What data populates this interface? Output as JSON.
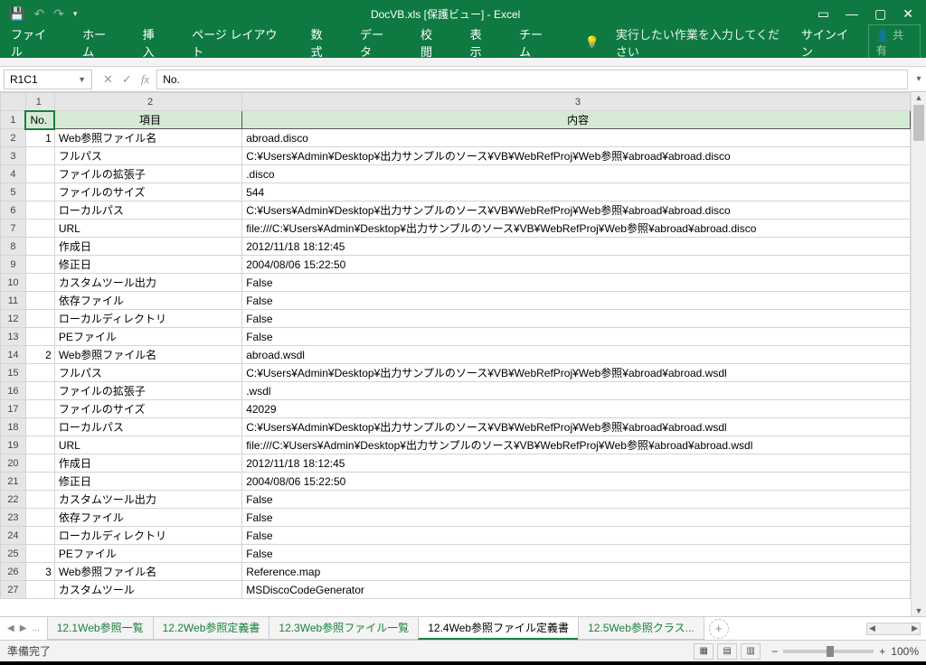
{
  "window": {
    "title": "DocVB.xls  [保護ビュー] - Excel"
  },
  "ribbon": {
    "tabs": [
      "ファイル",
      "ホーム",
      "挿入",
      "ページ レイアウト",
      "数式",
      "データ",
      "校閲",
      "表示",
      "チーム"
    ],
    "tellme": "実行したい作業を入力してください",
    "signin": "サインイン",
    "share": "共有"
  },
  "formula": {
    "namebox": "R1C1",
    "content": "No."
  },
  "columns": {
    "c1": "1",
    "c2": "2",
    "c3": "3"
  },
  "header_row": {
    "no": "No.",
    "item": "項目",
    "content": "内容"
  },
  "rows": [
    {
      "n": "1",
      "item": "Web参照ファイル名",
      "val": "abroad.disco"
    },
    {
      "n": "",
      "item": "フルパス",
      "val": "C:¥Users¥Admin¥Desktop¥出力サンプルのソース¥VB¥WebRefProj¥Web参照¥abroad¥abroad.disco"
    },
    {
      "n": "",
      "item": "ファイルの拡張子",
      "val": ".disco"
    },
    {
      "n": "",
      "item": "ファイルのサイズ",
      "val": "544"
    },
    {
      "n": "",
      "item": "ローカルパス",
      "val": "C:¥Users¥Admin¥Desktop¥出力サンプルのソース¥VB¥WebRefProj¥Web参照¥abroad¥abroad.disco"
    },
    {
      "n": "",
      "item": "URL",
      "val": "file:///C:¥Users¥Admin¥Desktop¥出力サンプルのソース¥VB¥WebRefProj¥Web参照¥abroad¥abroad.disco"
    },
    {
      "n": "",
      "item": "作成日",
      "val": "2012/11/18 18:12:45"
    },
    {
      "n": "",
      "item": "修正日",
      "val": "2004/08/06 15:22:50"
    },
    {
      "n": "",
      "item": "カスタムツール出力",
      "val": "False"
    },
    {
      "n": "",
      "item": "依存ファイル",
      "val": "False"
    },
    {
      "n": "",
      "item": "ローカルディレクトリ",
      "val": "False"
    },
    {
      "n": "",
      "item": "PEファイル",
      "val": "False"
    },
    {
      "n": "2",
      "item": "Web参照ファイル名",
      "val": "abroad.wsdl"
    },
    {
      "n": "",
      "item": "フルパス",
      "val": "C:¥Users¥Admin¥Desktop¥出力サンプルのソース¥VB¥WebRefProj¥Web参照¥abroad¥abroad.wsdl"
    },
    {
      "n": "",
      "item": "ファイルの拡張子",
      "val": ".wsdl"
    },
    {
      "n": "",
      "item": "ファイルのサイズ",
      "val": "42029"
    },
    {
      "n": "",
      "item": "ローカルパス",
      "val": "C:¥Users¥Admin¥Desktop¥出力サンプルのソース¥VB¥WebRefProj¥Web参照¥abroad¥abroad.wsdl"
    },
    {
      "n": "",
      "item": "URL",
      "val": "file:///C:¥Users¥Admin¥Desktop¥出力サンプルのソース¥VB¥WebRefProj¥Web参照¥abroad¥abroad.wsdl"
    },
    {
      "n": "",
      "item": "作成日",
      "val": "2012/11/18 18:12:45"
    },
    {
      "n": "",
      "item": "修正日",
      "val": "2004/08/06 15:22:50"
    },
    {
      "n": "",
      "item": "カスタムツール出力",
      "val": "False"
    },
    {
      "n": "",
      "item": "依存ファイル",
      "val": "False"
    },
    {
      "n": "",
      "item": "ローカルディレクトリ",
      "val": "False"
    },
    {
      "n": "",
      "item": "PEファイル",
      "val": "False"
    },
    {
      "n": "3",
      "item": "Web参照ファイル名",
      "val": "Reference.map"
    },
    {
      "n": "",
      "item": "カスタムツール",
      "val": "MSDiscoCodeGenerator"
    }
  ],
  "sheets": {
    "tabs": [
      "12.1Web参照一覧",
      "12.2Web参照定義書",
      "12.3Web参照ファイル一覧",
      "12.4Web参照ファイル定義書",
      "12.5Web参照クラス..."
    ],
    "active": 3,
    "ellipsis": "..."
  },
  "status": {
    "ready": "準備完了",
    "zoom": "100%"
  }
}
